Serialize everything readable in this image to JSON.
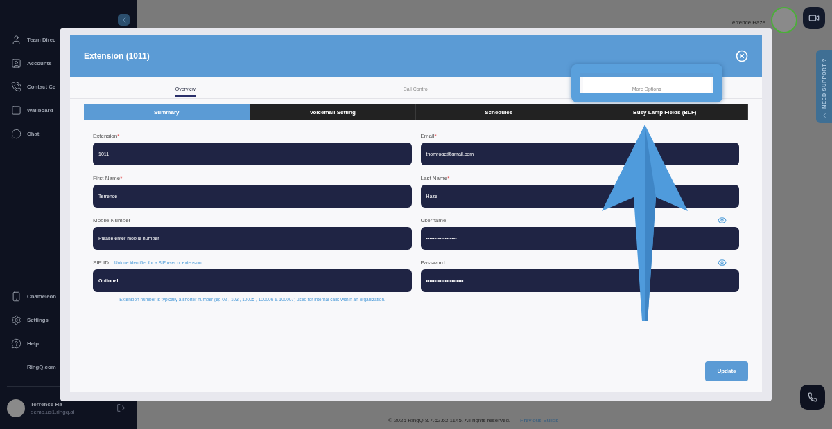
{
  "sidebar": {
    "items": [
      {
        "label": "Team Direc"
      },
      {
        "label": "Accounts"
      },
      {
        "label": "Contact Ce"
      },
      {
        "label": "Wallboard"
      },
      {
        "label": "Chat"
      }
    ],
    "bottom_items": [
      {
        "label": "Chameleon"
      },
      {
        "label": "Settings"
      },
      {
        "label": "Help"
      },
      {
        "label": "RingQ.com"
      }
    ],
    "user": {
      "name": "Terrence Ha",
      "email": "demo.us1.ringq.ai"
    }
  },
  "header": {
    "user_name": "Terrence Haze"
  },
  "support_tab": {
    "label": "NEED SUPPORT ?"
  },
  "modal": {
    "title": "Extension (1011)",
    "tabs": [
      {
        "label": "Overview",
        "selected": true,
        "highlighted": false
      },
      {
        "label": "Call Control",
        "selected": false,
        "highlighted": false
      },
      {
        "label": "More Options",
        "selected": false,
        "highlighted": true
      }
    ],
    "subtabs": [
      {
        "label": "Summary",
        "selected": true
      },
      {
        "label": "Voicemail Setting",
        "selected": false
      },
      {
        "label": "Schedules",
        "selected": false
      },
      {
        "label": "Busy Lamp Fields (BLF)",
        "selected": false
      }
    ],
    "fields": [
      {
        "label": "Extension",
        "required_mark": "*",
        "value": "1011"
      },
      {
        "label": "Email",
        "required_mark": "*",
        "value": "thomroge@gmail.com"
      },
      {
        "label": "First Name",
        "required_mark": "*",
        "value": "Terrence"
      },
      {
        "label": "Last Name",
        "required_mark": "*",
        "value": "Haze"
      },
      {
        "label": "Mobile Number",
        "placeholder": "Please enter mobile number"
      },
      {
        "label": "Username",
        "value": "••••••••••••••••••",
        "reveal": true
      },
      {
        "label": "SIP ID",
        "hint": "Unique identifier for a SIP user or extension.",
        "placeholder": "Optional"
      },
      {
        "label": "Password",
        "value": "••••••••••••••••••••••",
        "reveal": true
      }
    ],
    "note": "Extension number is typically a shorter number (eg 02 , 103 , 10005 , 100006 & 100007) used for internal calls within an organization.",
    "button": "Update"
  },
  "footer": {
    "copyright": "© 2025 RingQ 8.7.62.62.1145. All rights reserved.",
    "link": "Previous Builds"
  }
}
